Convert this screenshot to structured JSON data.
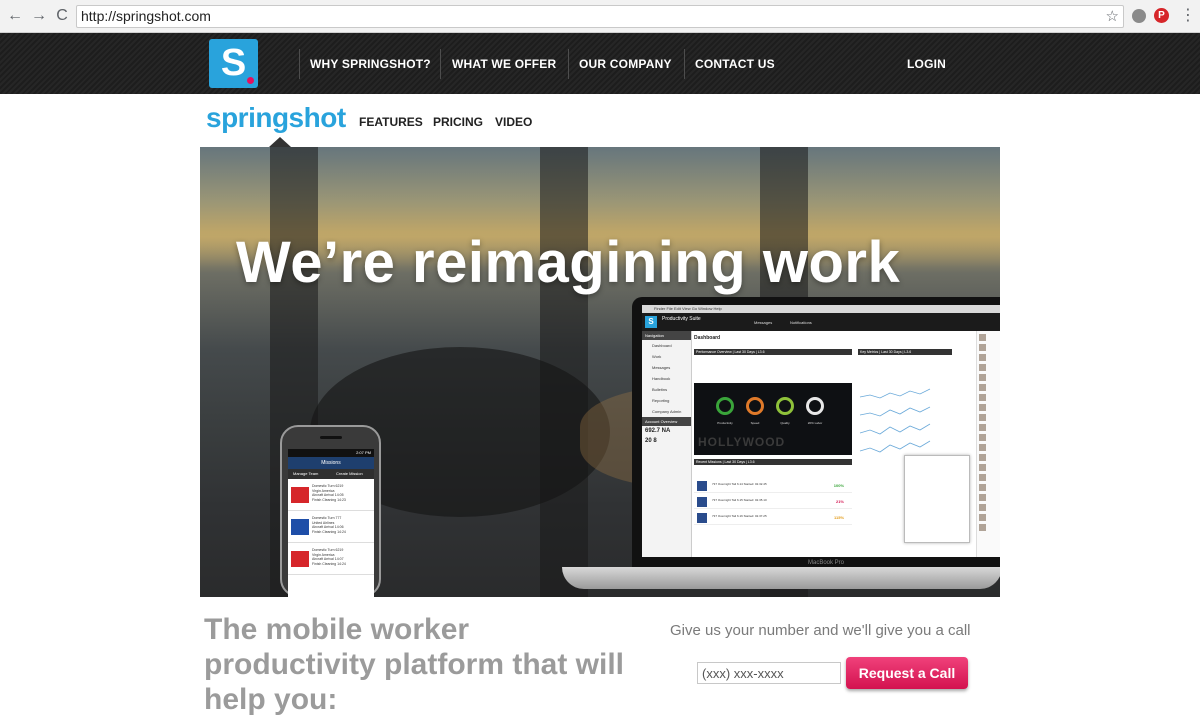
{
  "browser": {
    "url": "http://springshot.com",
    "back_icon": "←",
    "forward_icon": "→",
    "reload_icon": "C",
    "star_icon": "☆",
    "pinterest_icon": "P",
    "menu_icon": "⋮"
  },
  "topnav": {
    "logo_letter": "S",
    "items": [
      {
        "label": "WHY SPRINGSHOT?"
      },
      {
        "label": "WHAT WE OFFER"
      },
      {
        "label": "OUR COMPANY"
      },
      {
        "label": "CONTACT US"
      }
    ],
    "login": "LOGIN"
  },
  "subnav": {
    "brand": "springshot",
    "items": [
      {
        "label": "FEATURES"
      },
      {
        "label": "PRICING"
      },
      {
        "label": "VIDEO"
      }
    ]
  },
  "hero": {
    "headline": "We’re reimagining work",
    "laptop": {
      "menu": "Finder  File  Edit  View  Go  Window  Help",
      "app_title": "Productivity Suite",
      "messages": "Messages",
      "notifications": "Notifications",
      "dashboard_title": "Dashboard",
      "sidebar_header": "Navigation",
      "sidebar_items": [
        "Dashboard",
        "Work",
        "Messages",
        "Handbook",
        "Bulletins",
        "Reporting",
        "Company Admin"
      ],
      "overview_header": "Account Overview",
      "overview_stats": [
        "692.7   NA",
        "20      8"
      ],
      "performance_header": "Performance Overview | Last 30 Days | L3.6",
      "key_metrics_header": "Key Metrics | Last 30 Days | L3.6",
      "recent_header": "Recent Missions | Last 30 Days | L3.6",
      "gauge_labels": [
        "Productivity",
        "Speed",
        "Quality",
        "20% Labor"
      ],
      "background_text": "HOLLYWOOD",
      "rows": [
        {
          "text": "737 Overnight  Tail 6.14  Started: 02.32.45",
          "value": "100%",
          "color": "#3aa53a"
        },
        {
          "text": "737 Overnight  Tail 6.15  Started: 02.35.10",
          "value": "21%",
          "color": "#d3124f"
        },
        {
          "text": "737 Overnight  Tail 6.16  Started: 02.37.25",
          "value": "115%",
          "color": "#e39b17"
        }
      ],
      "model": "MacBook Pro"
    },
    "phone": {
      "time": "2:07 PM",
      "title": "Missions",
      "tabs": [
        "Manage Team",
        "Create Mission"
      ],
      "items": [
        {
          "title": "Domestic Turn 6219",
          "sub": "Virgin America",
          "line": "Aircraft Arrival  14:05",
          "line2": "Finish Cleaning  14:23",
          "logo_color": "#d6262a"
        },
        {
          "title": "Domestic Turn 777",
          "sub": "United Airlines",
          "line": "Aircraft Arrival  14:06",
          "line2": "Finish Cleaning  14:24",
          "logo_color": "#1e4ea8"
        },
        {
          "title": "Domestic Turn 6219",
          "sub": "Virgin America",
          "line": "Aircraft Arrival  14:07",
          "line2": "Finish Cleaning  14:24",
          "logo_color": "#d6262a"
        }
      ]
    }
  },
  "bottom": {
    "tagline": "The mobile worker productivity platform that will help you:",
    "call_prompt": "Give us your number and we'll give you a call",
    "phone_placeholder": "(xxx) xxx-xxxx",
    "request_button": "Request a Call"
  }
}
